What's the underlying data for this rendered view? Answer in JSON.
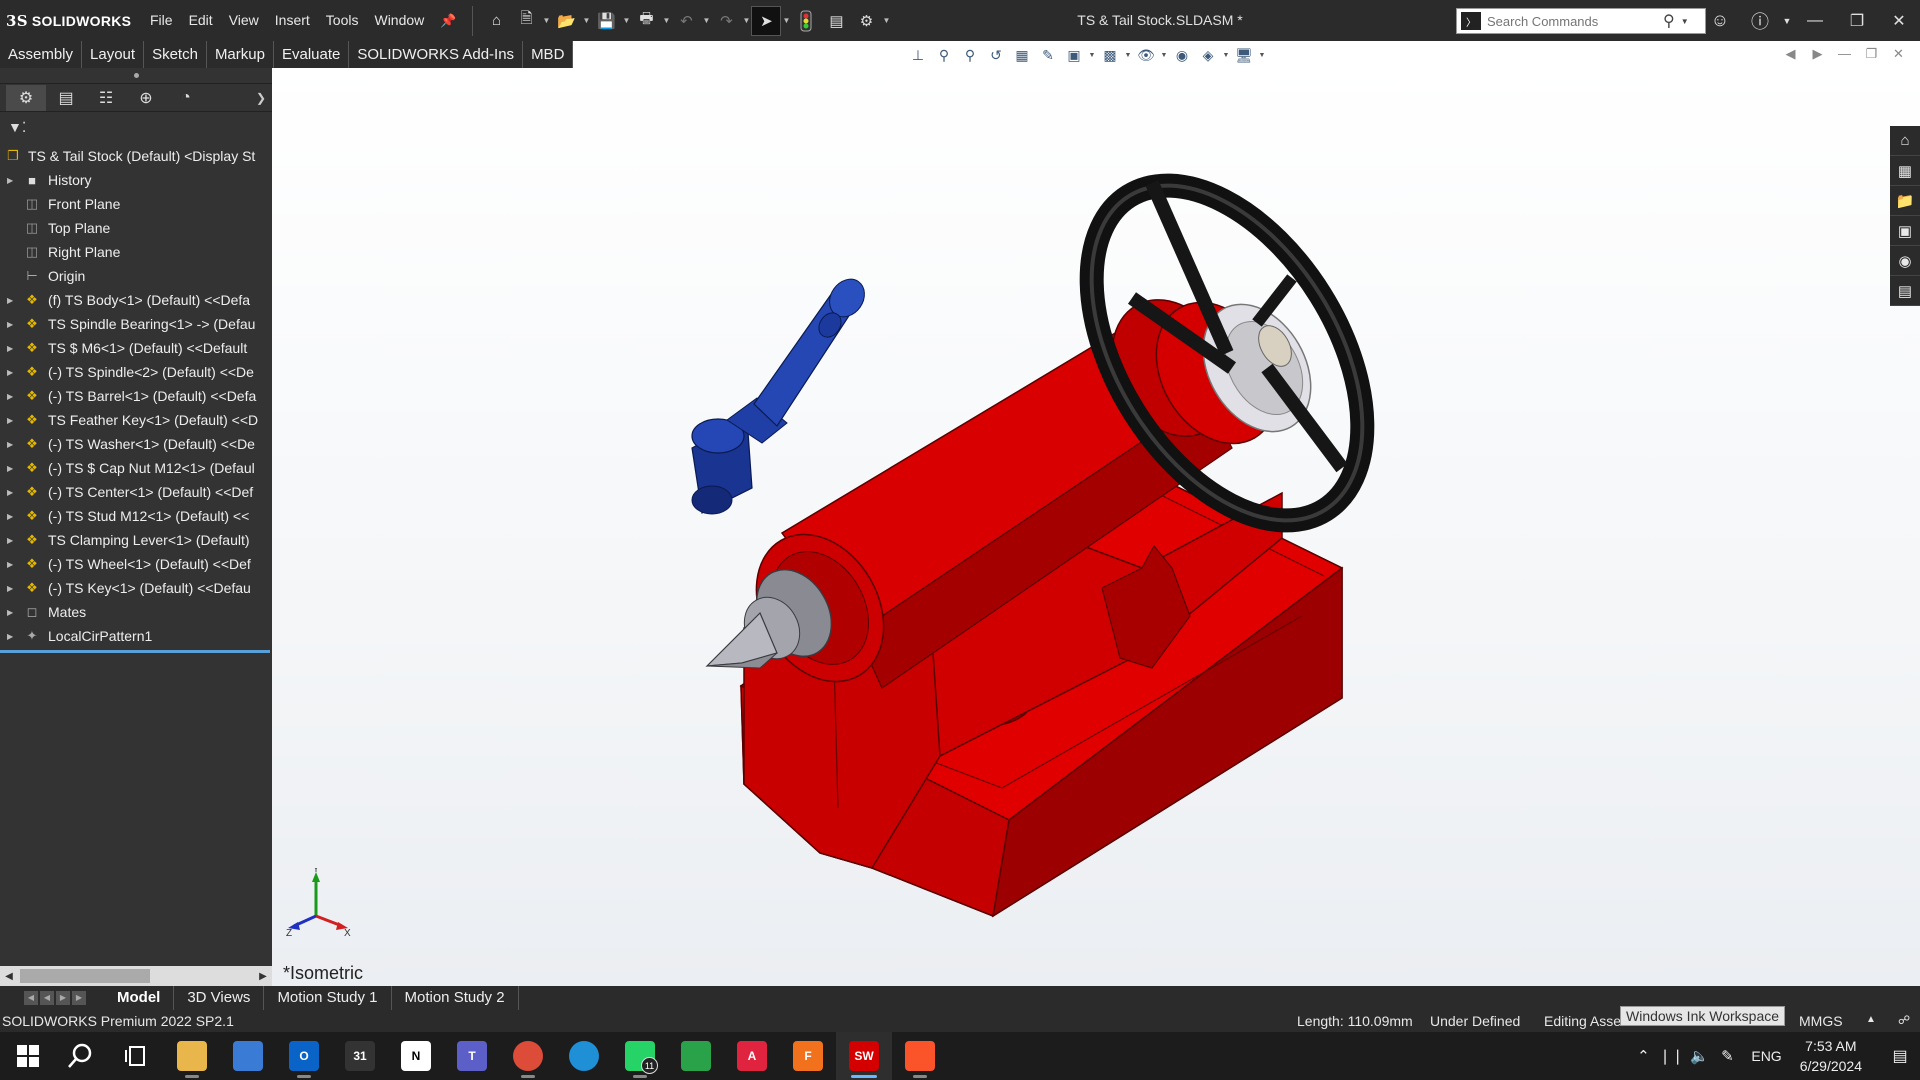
{
  "app": {
    "logo_text": "SOLIDWORKS",
    "logo_mark": "3S",
    "document_title": "TS & Tail Stock.SLDASM *"
  },
  "menu": [
    "File",
    "Edit",
    "View",
    "Insert",
    "Tools",
    "Window"
  ],
  "search": {
    "placeholder": "Search Commands"
  },
  "command_tabs": [
    "Assembly",
    "Layout",
    "Sketch",
    "Markup",
    "Evaluate",
    "SOLIDWORKS Add-Ins",
    "MBD"
  ],
  "feature_tree": {
    "root": "TS & Tail Stock (Default) <Display St",
    "items": [
      {
        "label": "History",
        "icon": "history-icon",
        "expandable": true
      },
      {
        "label": "Front Plane",
        "icon": "plane-icon",
        "expandable": false
      },
      {
        "label": "Top Plane",
        "icon": "plane-icon",
        "expandable": false
      },
      {
        "label": "Right Plane",
        "icon": "plane-icon",
        "expandable": false
      },
      {
        "label": "Origin",
        "icon": "origin-icon",
        "expandable": false
      },
      {
        "label": "(f) TS Body<1> (Default) <<Defa",
        "icon": "part-icon",
        "expandable": true
      },
      {
        "label": "TS Spindle Bearing<1> -> (Defau",
        "icon": "part-icon",
        "expandable": true
      },
      {
        "label": "TS $ M6<1> (Default) <<Default",
        "icon": "part-icon",
        "expandable": true
      },
      {
        "label": "(-) TS Spindle<2> (Default) <<De",
        "icon": "part-icon",
        "expandable": true
      },
      {
        "label": "(-) TS Barrel<1> (Default) <<Defa",
        "icon": "part-icon",
        "expandable": true
      },
      {
        "label": "TS Feather Key<1> (Default) <<D",
        "icon": "part-icon",
        "expandable": true
      },
      {
        "label": "(-) TS Washer<1> (Default) <<De",
        "icon": "part-icon",
        "expandable": true
      },
      {
        "label": "(-) TS $ Cap Nut M12<1> (Defaul",
        "icon": "part-icon",
        "expandable": true
      },
      {
        "label": "(-) TS Center<1> (Default) <<Def",
        "icon": "part-icon",
        "expandable": true
      },
      {
        "label": "(-) TS Stud M12<1> (Default) <<",
        "icon": "part-icon",
        "expandable": true
      },
      {
        "label": "TS Clamping Lever<1> (Default)",
        "icon": "part-icon",
        "expandable": true
      },
      {
        "label": "(-) TS Wheel<1> (Default) <<Def",
        "icon": "part-icon",
        "expandable": true
      },
      {
        "label": "(-) TS Key<1> (Default) <<Defau",
        "icon": "part-icon",
        "expandable": true
      },
      {
        "label": "Mates",
        "icon": "mates-icon",
        "expandable": true
      },
      {
        "label": "LocalCirPattern1",
        "icon": "pattern-icon",
        "expandable": true
      }
    ]
  },
  "viewport": {
    "view_label": "*Isometric",
    "triad": {
      "y": "Y",
      "z": "Z",
      "x": "X"
    },
    "colors": {
      "body": "#c80000",
      "lever": "#1f3a99",
      "wheel": "#1a1a1a",
      "center": "#9a9aa0"
    }
  },
  "bottom_tabs": [
    "Model",
    "3D Views",
    "Motion Study 1",
    "Motion Study 2"
  ],
  "status": {
    "app_version": "SOLIDWORKS Premium 2022 SP2.1",
    "length": "Length: 110.09mm",
    "defined": "Under Defined",
    "editing": "Editing Assem",
    "units": "MMGS",
    "tooltip": "Windows Ink Workspace"
  },
  "taskbar": {
    "apps": [
      {
        "name": "file-explorer",
        "label": "",
        "color": "#e8b64a"
      },
      {
        "name": "microsoft-store",
        "label": "",
        "color": "#3a7bd5"
      },
      {
        "name": "outlook",
        "label": "O",
        "color": "#0a64c8"
      },
      {
        "name": "calendar",
        "label": "31",
        "color": "#333333"
      },
      {
        "name": "notion",
        "label": "N",
        "color": "#ffffff"
      },
      {
        "name": "teams",
        "label": "T",
        "color": "#5b5fc7"
      },
      {
        "name": "chrome",
        "label": "",
        "color": "#dd4b39"
      },
      {
        "name": "edge",
        "label": "",
        "color": "#1f8fd6"
      },
      {
        "name": "whatsapp",
        "label": "",
        "color": "#25d366"
      },
      {
        "name": "download-app",
        "label": "",
        "color": "#2aa24a"
      },
      {
        "name": "autocad",
        "label": "A",
        "color": "#e0233f"
      },
      {
        "name": "fusion",
        "label": "F",
        "color": "#f2711c"
      },
      {
        "name": "solidworks",
        "label": "SW",
        "color": "#d40000"
      },
      {
        "name": "brave",
        "label": "",
        "color": "#fb542b"
      }
    ],
    "whatsapp_badge": "11",
    "language": "ENG",
    "time": "7:53 AM",
    "date": "6/29/2024"
  }
}
